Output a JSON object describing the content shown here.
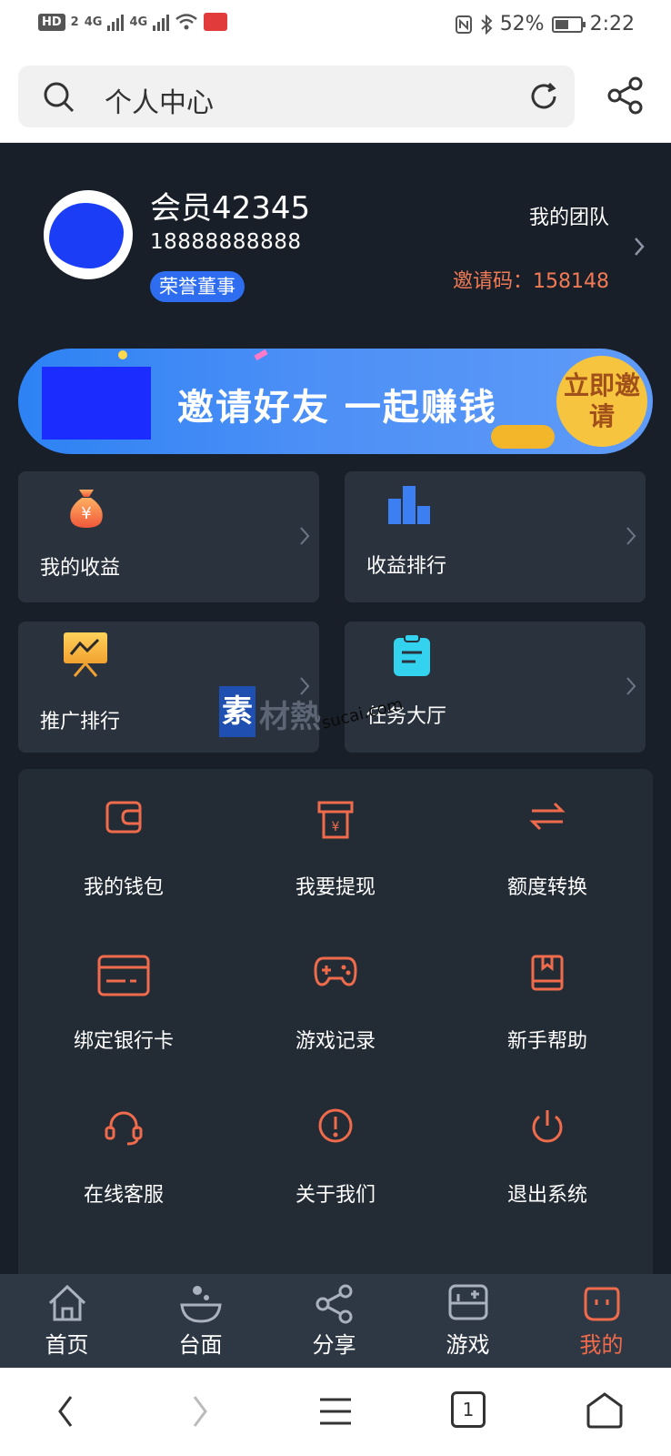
{
  "status_bar": {
    "hd": "HD",
    "hd_sub": "2",
    "net1": "4G",
    "net2": "4G",
    "battery": "52%",
    "time": "2:22"
  },
  "browser": {
    "url_text": "个人中心"
  },
  "profile": {
    "name": "会员42345",
    "phone": "18888888888",
    "badge": "荣誉董事",
    "team_label": "我的团队",
    "invite_code": "邀请码：158148"
  },
  "banner": {
    "text": "邀请好友 一起赚钱",
    "cta": "立即邀请"
  },
  "cards": [
    {
      "label": "我的收益",
      "icon": "money-bag-icon"
    },
    {
      "label": "收益排行",
      "icon": "bar-chart-icon"
    },
    {
      "label": "推广排行",
      "icon": "presentation-board-icon"
    },
    {
      "label": "任务大厅",
      "icon": "clipboard-icon"
    }
  ],
  "grid_items": [
    {
      "label": "我的钱包",
      "icon": "wallet-icon"
    },
    {
      "label": "我要提现",
      "icon": "withdraw-icon"
    },
    {
      "label": "额度转换",
      "icon": "transfer-icon"
    },
    {
      "label": "绑定银行卡",
      "icon": "bank-card-icon"
    },
    {
      "label": "游戏记录",
      "icon": "gamepad-icon"
    },
    {
      "label": "新手帮助",
      "icon": "book-icon"
    },
    {
      "label": "在线客服",
      "icon": "headset-icon"
    },
    {
      "label": "关于我们",
      "icon": "info-icon"
    },
    {
      "label": "退出系统",
      "icon": "power-icon"
    }
  ],
  "watermark": {
    "logo": "素",
    "text": "材熱",
    "sub": "sucai.com"
  },
  "tabs": [
    {
      "label": "首页",
      "icon": "home-icon"
    },
    {
      "label": "台面",
      "icon": "table-bowl-icon"
    },
    {
      "label": "分享",
      "icon": "share-icon"
    },
    {
      "label": "游戏",
      "icon": "game-icon"
    },
    {
      "label": "我的",
      "icon": "profile-face-icon",
      "active": true
    }
  ],
  "system_nav": {
    "tab_count": "1"
  },
  "colors": {
    "main_bg": "#191f28",
    "card_bg": "#2a323d",
    "accent_orange": "#f06b4b",
    "badge_blue": "#2f6df0",
    "tabbar_bg": "#2e3845"
  }
}
